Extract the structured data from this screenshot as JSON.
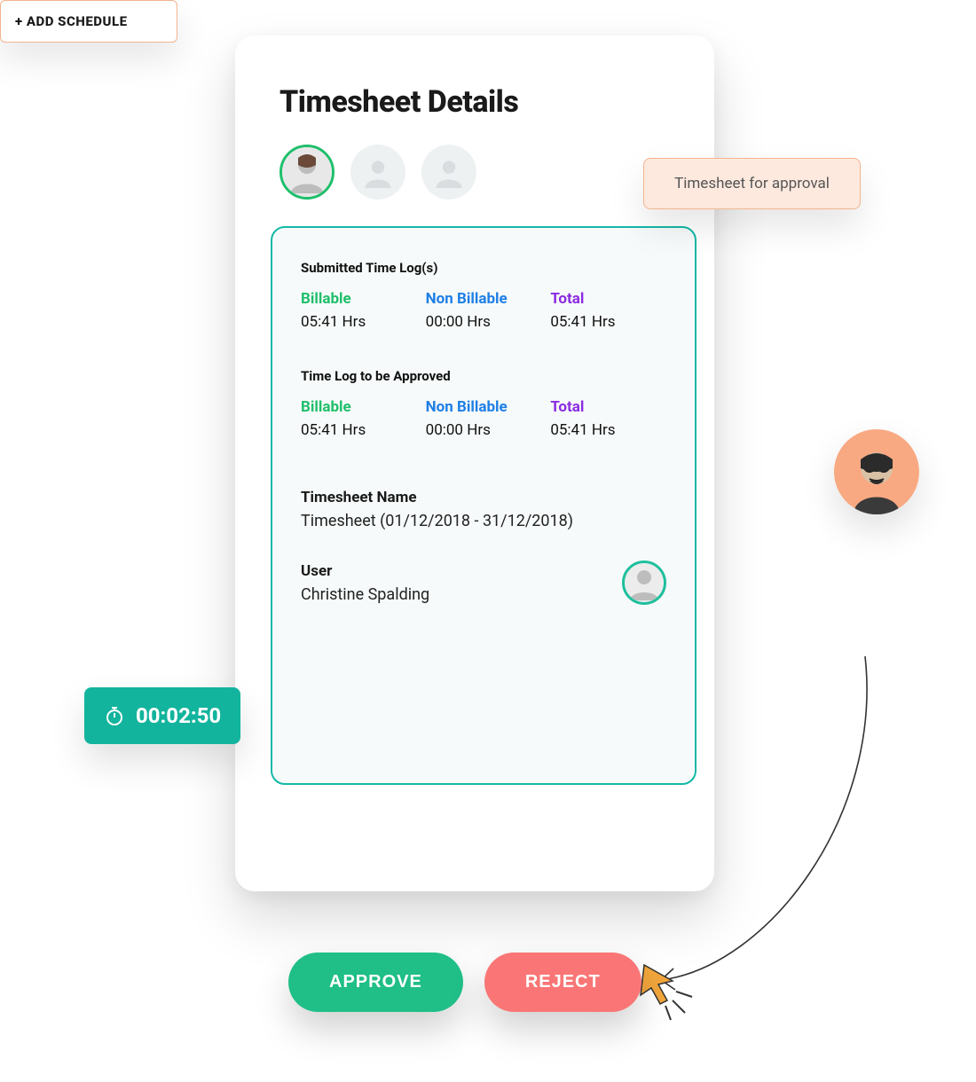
{
  "title": "Timesheet Details",
  "callouts": {
    "approval": "Timesheet for approval",
    "add_schedule": "+ ADD SCHEDULE"
  },
  "timer": {
    "value": "00:02:50"
  },
  "sections": {
    "submitted": {
      "label": "Submitted Time Log(s)",
      "billable_label": "Billable",
      "billable_value": "05:41 Hrs",
      "nonbillable_label": "Non Billable",
      "nonbillable_value": "00:00 Hrs",
      "total_label": "Total",
      "total_value": "05:41 Hrs"
    },
    "to_approve": {
      "label": "Time Log to be Approved",
      "billable_label": "Billable",
      "billable_value": "05:41 Hrs",
      "nonbillable_label": "Non Billable",
      "nonbillable_value": "00:00 Hrs",
      "total_label": "Total",
      "total_value": "05:41 Hrs"
    }
  },
  "fields": {
    "name_label": "Timesheet Name",
    "name_value": "Timesheet (01/12/2018 - 31/12/2018)",
    "user_label": "User",
    "user_value": "Christine Spalding"
  },
  "buttons": {
    "approve": "APPROVE",
    "reject": "REJECT"
  }
}
